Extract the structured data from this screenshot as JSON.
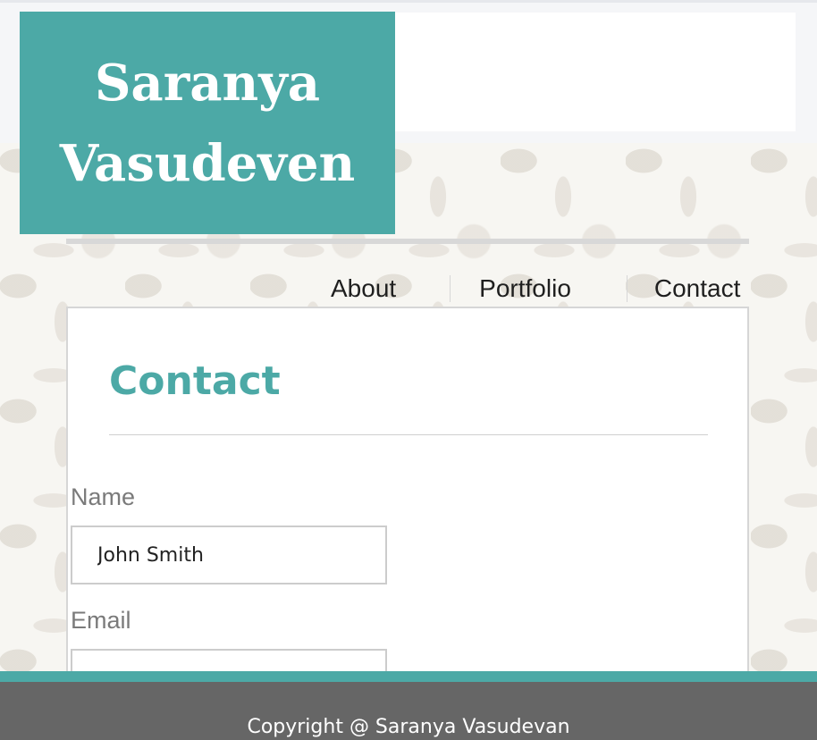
{
  "header": {
    "name_line1": "Saranya",
    "name_line2": "Vasudeven"
  },
  "nav": {
    "items": [
      {
        "label": "About"
      },
      {
        "label": "Portfolio"
      },
      {
        "label": "Contact"
      }
    ]
  },
  "contact": {
    "title": "Contact",
    "fields": {
      "name": {
        "label": "Name",
        "value": "John Smith"
      },
      "email": {
        "label": "Email",
        "value": ""
      }
    }
  },
  "footer": {
    "copyright": "Copyright @ Saranya Vasudevan"
  },
  "colors": {
    "accent": "#4ca9a6",
    "footer": "#666666",
    "text_muted": "#7a7a7a"
  }
}
